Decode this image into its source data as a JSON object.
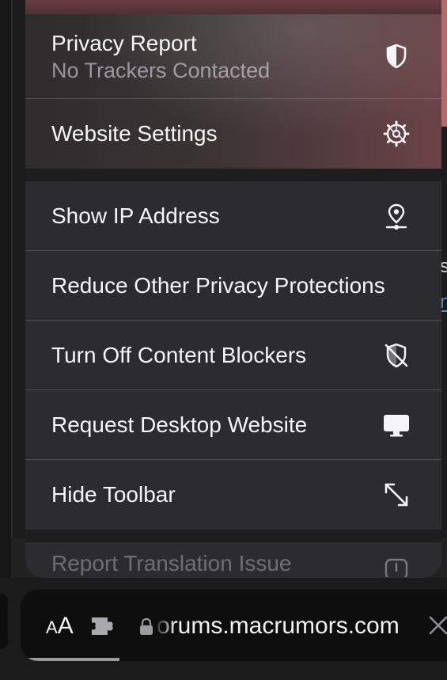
{
  "menu": {
    "group1": [
      {
        "label": "Privacy Report",
        "sublabel": "No Trackers Contacted",
        "icon": "shield-half-icon"
      },
      {
        "label": "Website Settings",
        "icon": "gear-icon"
      }
    ],
    "group2": [
      {
        "label": "Show IP Address",
        "icon": "location-pin-icon"
      },
      {
        "label": "Reduce Other Privacy Protections",
        "icon": ""
      },
      {
        "label": "Turn Off Content Blockers",
        "icon": "shield-slash-icon"
      },
      {
        "label": "Request Desktop Website",
        "icon": "desktop-icon"
      },
      {
        "label": "Hide Toolbar",
        "icon": "expand-arrows-icon"
      }
    ],
    "group3": [
      {
        "label": "Report Translation Issue",
        "icon": "exclamation-bubble-icon"
      }
    ]
  },
  "addressbar": {
    "text_size_label_small": "A",
    "text_size_label_large": "A",
    "url": "orums.macrumors.com",
    "icons": [
      "puzzle-extension-icon",
      "lock-icon",
      "close-icon"
    ]
  },
  "background": {
    "partial_text": "s",
    "partial_link": "n"
  },
  "colors": {
    "menu_bg": "#2c2c2e",
    "text_primary": "#f5f5f7",
    "text_secondary": "#8e8e93",
    "accent_red": "#b36a6b",
    "link_blue": "#5a8dc4"
  }
}
